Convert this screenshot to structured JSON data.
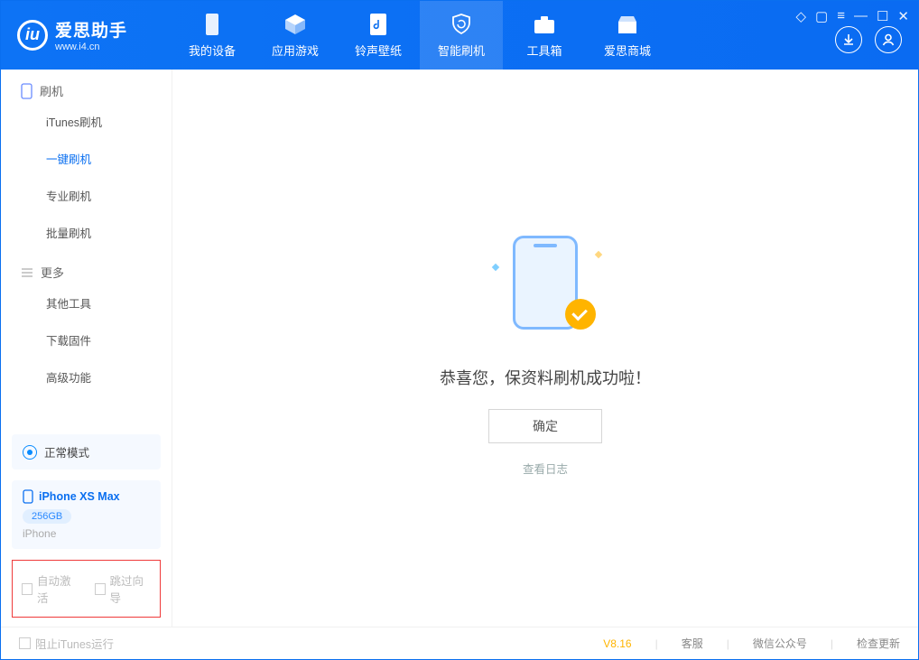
{
  "app": {
    "name_cn": "爱思助手",
    "url": "www.i4.cn"
  },
  "tabs": {
    "t0": "我的设备",
    "t1": "应用游戏",
    "t2": "铃声壁纸",
    "t3": "智能刷机",
    "t4": "工具箱",
    "t5": "爱思商城"
  },
  "sidebar": {
    "sec1": "刷机",
    "items1": {
      "a": "iTunes刷机",
      "b": "一键刷机",
      "c": "专业刷机",
      "d": "批量刷机"
    },
    "sec2": "更多",
    "items2": {
      "a": "其他工具",
      "b": "下载固件",
      "c": "高级功能"
    },
    "mode": "正常模式",
    "device": {
      "name": "iPhone XS Max",
      "capacity": "256GB",
      "sub": "iPhone"
    },
    "red": {
      "c1": "自动激活",
      "c2": "跳过向导"
    }
  },
  "main": {
    "message": "恭喜您，保资料刷机成功啦！",
    "ok": "确定",
    "loglink": "查看日志"
  },
  "footer": {
    "block_itunes": "阻止iTunes运行",
    "version": "V8.16",
    "l1": "客服",
    "l2": "微信公众号",
    "l3": "检查更新"
  }
}
